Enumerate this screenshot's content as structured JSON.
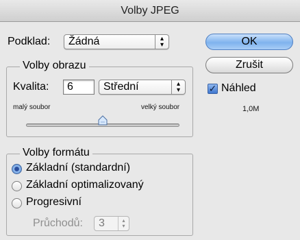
{
  "window": {
    "title": "Volby JPEG"
  },
  "matte": {
    "label": "Podklad:",
    "value": "Žádná"
  },
  "image_options": {
    "group_title": "Volby obrazu",
    "quality_label": "Kvalita:",
    "quality_value": "6",
    "quality_preset": "Střední",
    "small_file_label": "malý soubor",
    "large_file_label": "velký soubor",
    "slider_level": 0.5
  },
  "format_options": {
    "group_title": "Volby formátu",
    "options": [
      {
        "label": "Základní (standardní)",
        "selected": true
      },
      {
        "label": "Základní optimalizovaný",
        "selected": false
      },
      {
        "label": "Progresivní",
        "selected": false
      }
    ],
    "scans_label": "Průchodů:",
    "scans_value": "3"
  },
  "buttons": {
    "ok": "OK",
    "cancel": "Zrušit"
  },
  "preview": {
    "label": "Náhled",
    "checked": true,
    "file_size": "1,0M"
  }
}
